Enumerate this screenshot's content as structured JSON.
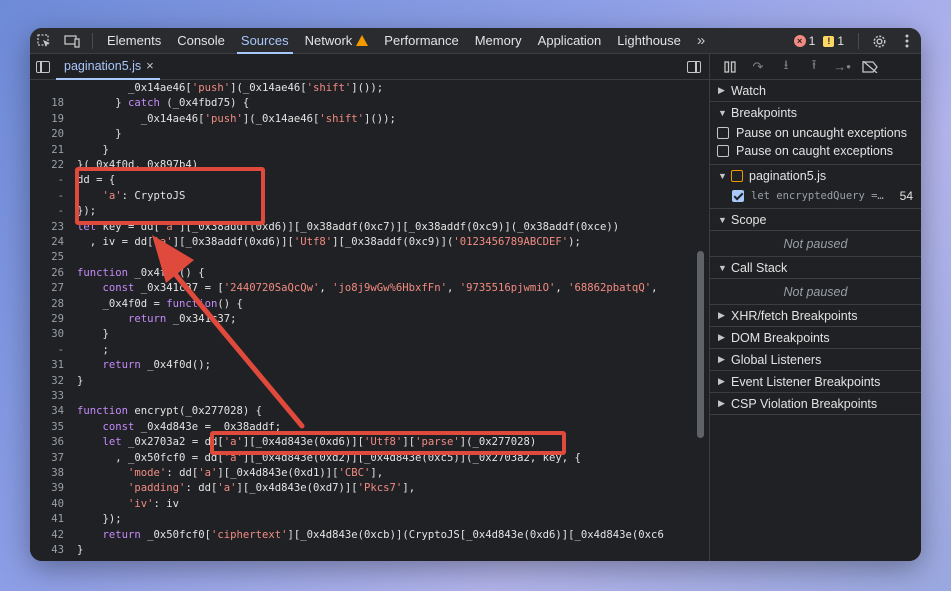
{
  "toolbar": {
    "tabs": [
      "Elements",
      "Console",
      "Sources",
      "Network",
      "Performance",
      "Memory",
      "Application",
      "Lighthouse"
    ],
    "active_tab": "Sources",
    "more": "»",
    "errors_count": "1",
    "warnings_count": "1"
  },
  "file_tab": {
    "name": "pagination5.js",
    "close": "×"
  },
  "code_lines": [
    {
      "n": "",
      "html": "        _0x14ae46['push'](_0x14ae46['shift']());"
    },
    {
      "n": "18",
      "html": "      } catch (_0x4fbd75) {"
    },
    {
      "n": "19",
      "html": "          _0x14ae46['push'](_0x14ae46['shift']());"
    },
    {
      "n": "20",
      "html": "      }"
    },
    {
      "n": "21",
      "html": "    }"
    },
    {
      "n": "22",
      "html": "}(_0x4f0d, 0x897b4)"
    },
    {
      "n": "-",
      "html": "dd = {"
    },
    {
      "n": "-",
      "html": "    'a': CryptoJS"
    },
    {
      "n": "-",
      "html": "});"
    },
    {
      "n": "23",
      "html": "let key = dd['a'][_0x38addf(0xd6)][_0x38addf(0xc7)][_0x38addf(0xc9)](_0x38addf(0xce))"
    },
    {
      "n": "24",
      "html": "  , iv = dd['a'][_0x38addf(0xd6)]['Utf8'][_0x38addf(0xc9)]('0123456789ABCDEF');"
    },
    {
      "n": "25",
      "html": ""
    },
    {
      "n": "26",
      "html": "function _0x4f0d() {"
    },
    {
      "n": "27",
      "html": "    const _0x341c37 = ['2440720SaQcQw', 'jo8j9wGw%6HbxfFn', '9735516pjwmiO', '68862pbatqQ',"
    },
    {
      "n": "28",
      "html": "    _0x4f0d = function() {"
    },
    {
      "n": "29",
      "html": "        return _0x341c37;"
    },
    {
      "n": "30",
      "html": "    }"
    },
    {
      "n": "-",
      "html": "    ;"
    },
    {
      "n": "31",
      "html": "    return _0x4f0d();"
    },
    {
      "n": "32",
      "html": "}"
    },
    {
      "n": "33",
      "html": ""
    },
    {
      "n": "34",
      "html": "function encrypt(_0x277028) {"
    },
    {
      "n": "35",
      "html": "    const _0x4d843e = _0x38addf;"
    },
    {
      "n": "36",
      "html": "    let _0x2703a2 = dd['a'][_0x4d843e(0xd6)]['Utf8']['parse'](_0x277028)"
    },
    {
      "n": "37",
      "html": "      , _0x50fcf0 = dd['a'][_0x4d843e(0xd2)][_0x4d843e(0xc5)](_0x2703a2, key, {"
    },
    {
      "n": "38",
      "html": "        'mode': dd['a'][_0x4d843e(0xd1)]['CBC'],"
    },
    {
      "n": "39",
      "html": "        'padding': dd['a'][_0x4d843e(0xd7)]['Pkcs7'],"
    },
    {
      "n": "40",
      "html": "        'iv': iv"
    },
    {
      "n": "41",
      "html": "    });"
    },
    {
      "n": "42",
      "html": "    return _0x50fcf0['ciphertext'][_0x4d843e(0xcb)](CryptoJS[_0x4d843e(0xd6)][_0x4d843e(0xc6"
    },
    {
      "n": "43",
      "html": "}"
    }
  ],
  "sidebar": {
    "watch": "Watch",
    "breakpoints": "Breakpoints",
    "pause_uncaught": "Pause on uncaught exceptions",
    "pause_caught": "Pause on caught exceptions",
    "bp_file": "pagination5.js",
    "bp_code": "let encryptedQuery =…",
    "bp_line": "54",
    "scope": "Scope",
    "scope_status": "Not paused",
    "call_stack": "Call Stack",
    "call_stack_status": "Not paused",
    "xhr": "XHR/fetch Breakpoints",
    "dom": "DOM Breakpoints",
    "global": "Global Listeners",
    "event": "Event Listener Breakpoints",
    "csp": "CSP Violation Breakpoints"
  },
  "colors": {
    "accent": "#a8c7fa",
    "annotation": "#e04a3c"
  }
}
